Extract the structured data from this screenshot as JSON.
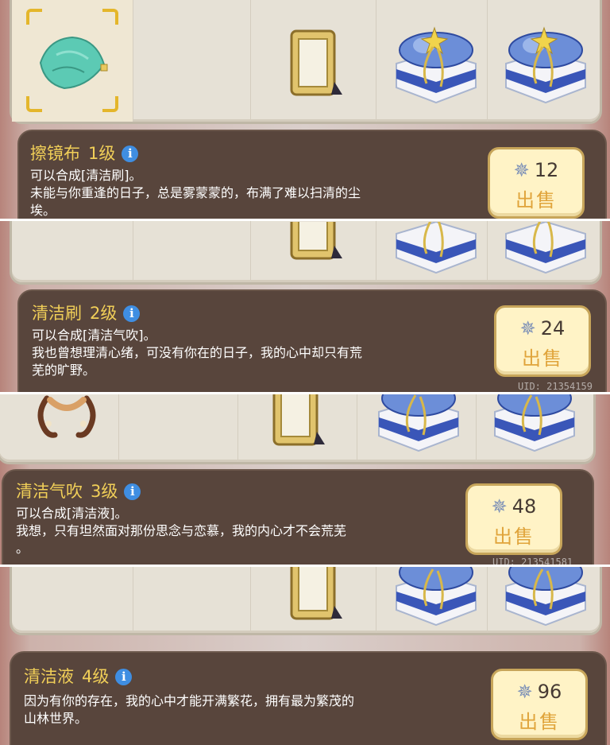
{
  "items": [
    {
      "name": "擦镜布",
      "level": "1级",
      "line1": "可以合成[清洁刷]。",
      "line2": "未能与你重逢的日子，总是雾蒙蒙的，布满了难以扫清的尘",
      "line3": "埃。",
      "price": "12",
      "sell_label": "出售"
    },
    {
      "name": "清洁刷",
      "level": "2级",
      "line1": "可以合成[清洁气吹]。",
      "line2": "我也曾想理清心绪，可没有你在的日子，我的心中却只有荒",
      "line3": "芜的旷野。",
      "price": "24",
      "sell_label": "出售"
    },
    {
      "name": "清洁气吹",
      "level": "3级",
      "line1": "可以合成[清洁液]。",
      "line2": "我想，只有坦然面对那份思念与恋慕，我的内心才不会荒芜",
      "line3": "。",
      "price": "48",
      "sell_label": "出售"
    },
    {
      "name": "清洁液",
      "level": "4级",
      "line1": "因为有你的存在，我的心中才能开满繁花，拥有最为繁茂的",
      "line2": "山林世界。",
      "line3": "",
      "price": "96",
      "sell_label": "出售"
    }
  ],
  "uid_text": "UID: 21354159",
  "uid_text_short": "UID: 213541581",
  "icons": {
    "info": "info-icon",
    "currency": "star-currency-icon",
    "cloth": "cloth-item-icon",
    "frame": "mirror-frame-icon",
    "gift": "gift-box-icon",
    "rope": "rope-item-icon"
  },
  "colors": {
    "panel": "#58453c",
    "title": "#f1cf58",
    "sell_bg": "#fff3c6",
    "sell_text": "#e0a43b",
    "info": "#3f8ee2"
  }
}
